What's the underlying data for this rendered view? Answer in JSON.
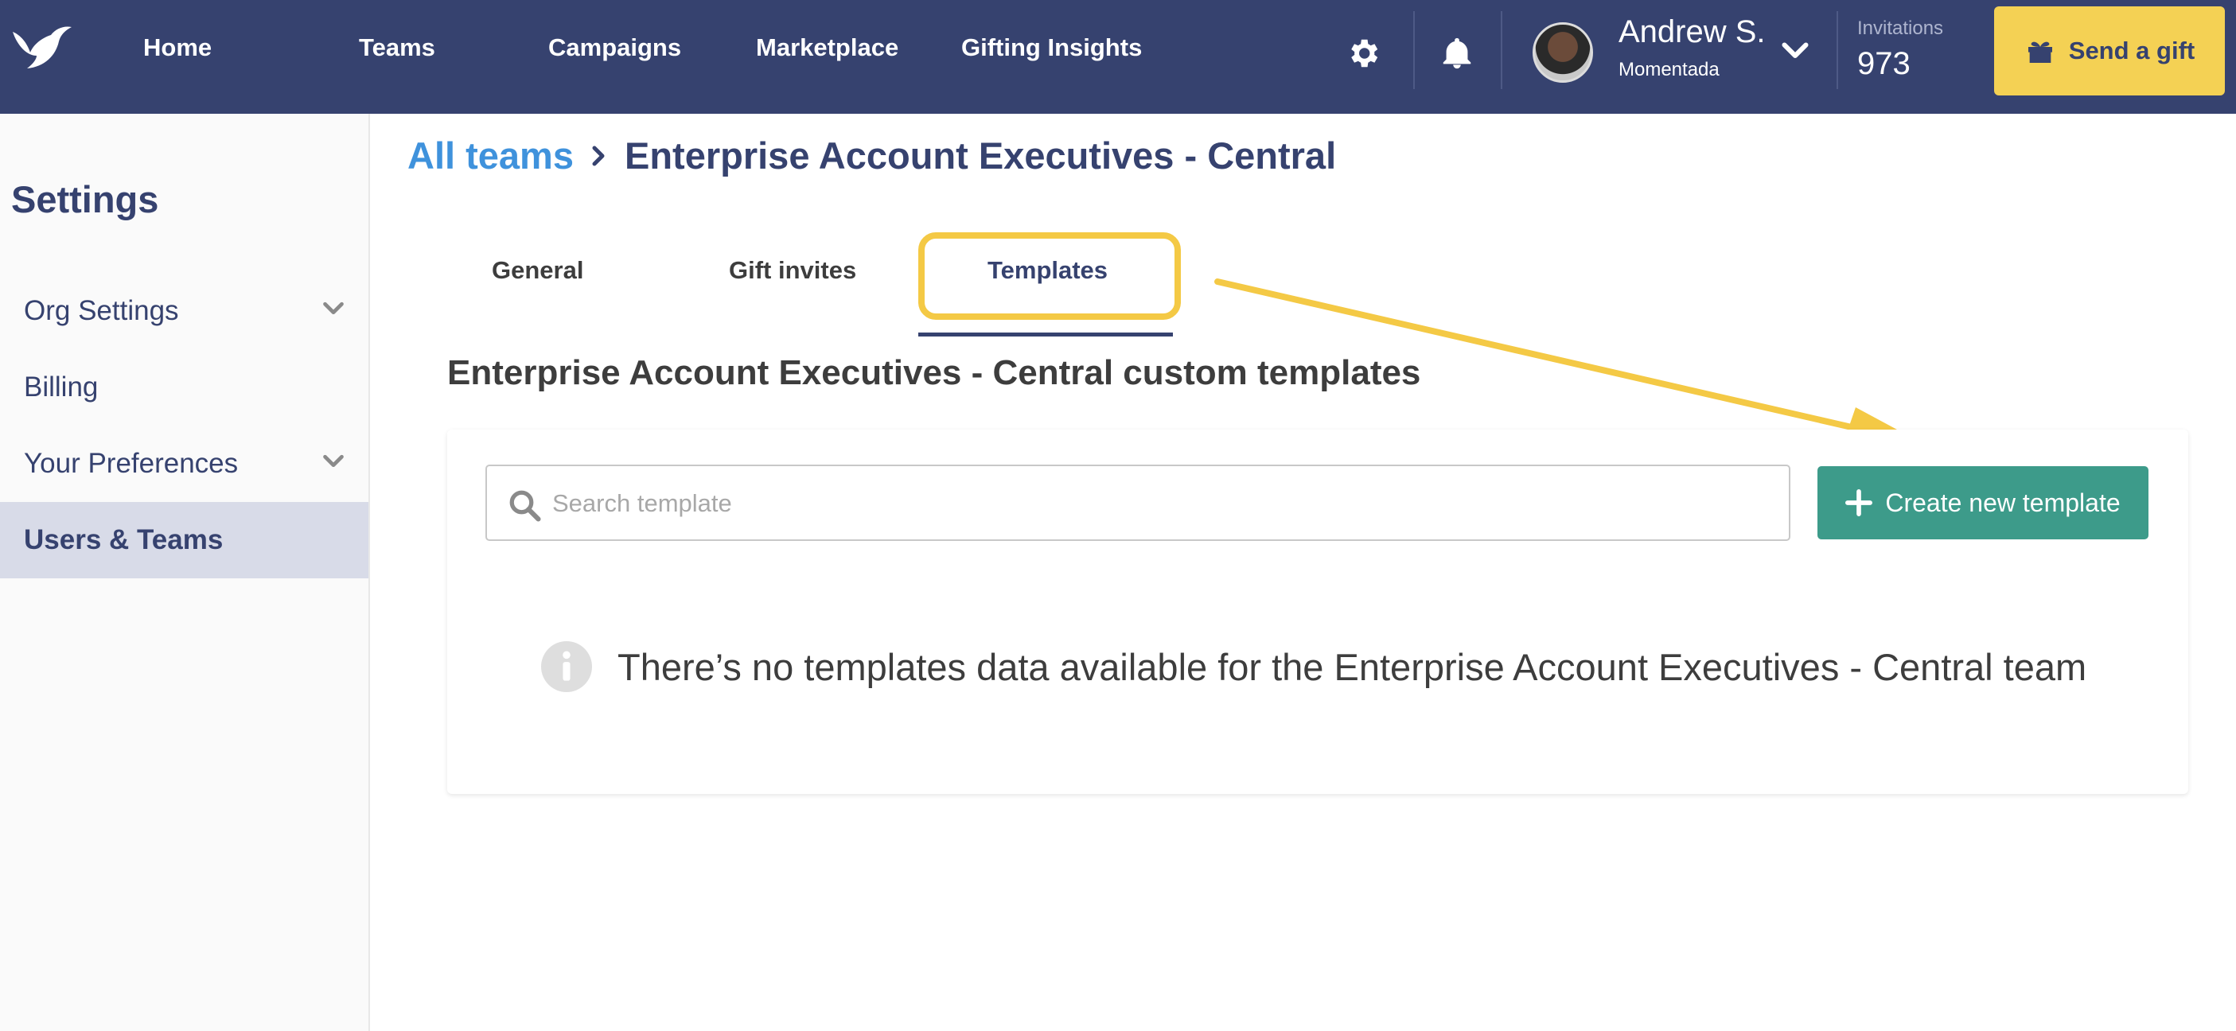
{
  "nav": {
    "links": [
      "Home",
      "Teams",
      "Campaigns",
      "Marketplace",
      "Gifting Insights"
    ],
    "user_name": "Andrew S.",
    "user_org": "Momentada",
    "invitations_label": "Invitations",
    "invitations_count": "973",
    "send_gift_label": "Send a gift"
  },
  "sidebar": {
    "title": "Settings",
    "items": [
      {
        "label": "Org Settings",
        "expandable": true
      },
      {
        "label": "Billing",
        "expandable": false
      },
      {
        "label": "Your Preferences",
        "expandable": true
      },
      {
        "label": "Users & Teams",
        "expandable": false,
        "active": true
      }
    ]
  },
  "breadcrumb": {
    "parent": "All teams",
    "current": "Enterprise Account Executives - Central"
  },
  "tabs": [
    {
      "label": "General"
    },
    {
      "label": "Gift invites"
    },
    {
      "label": "Templates",
      "active": true
    }
  ],
  "section": {
    "title": "Enterprise Account Executives - Central custom templates"
  },
  "search": {
    "placeholder": "Search template",
    "value": ""
  },
  "create_button_label": "Create new template",
  "empty_message": "There’s no templates data available for the Enterprise Account Executives - Central team",
  "colors": {
    "nav_bg": "#36426f",
    "accent_yellow": "#f4d154",
    "highlight_yellow": "#f4c945",
    "create_green": "#3d9b8a",
    "link_blue": "#3f92dc"
  }
}
